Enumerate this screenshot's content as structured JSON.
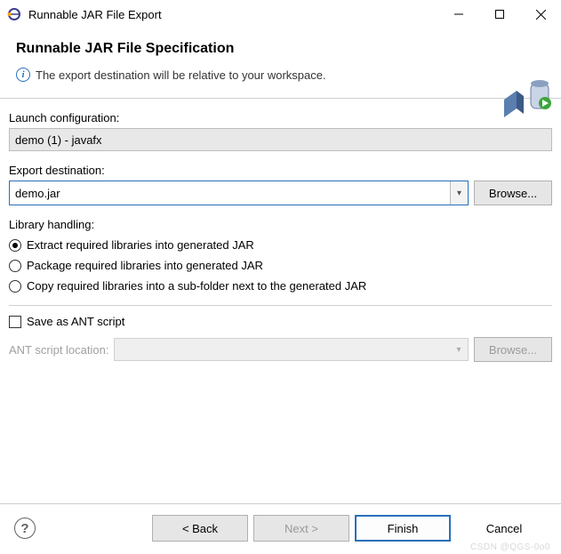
{
  "window": {
    "title": "Runnable JAR File Export"
  },
  "header": {
    "title": "Runnable JAR File Specification",
    "message": "The export destination will be relative to your workspace."
  },
  "launch": {
    "label": "Launch configuration:",
    "value": "demo (1) - javafx"
  },
  "export": {
    "label": "Export destination:",
    "value": "demo.jar",
    "browse": "Browse..."
  },
  "library": {
    "label": "Library handling:",
    "options": [
      "Extract required libraries into generated JAR",
      "Package required libraries into generated JAR",
      "Copy required libraries into a sub-folder next to the generated JAR"
    ],
    "selected": 0
  },
  "ant": {
    "checkbox_label": "Save as ANT script",
    "location_label": "ANT script location:",
    "browse": "Browse..."
  },
  "buttons": {
    "back": "< Back",
    "next": "Next >",
    "finish": "Finish",
    "cancel": "Cancel"
  },
  "watermark": "CSDN @QGS-0o0"
}
